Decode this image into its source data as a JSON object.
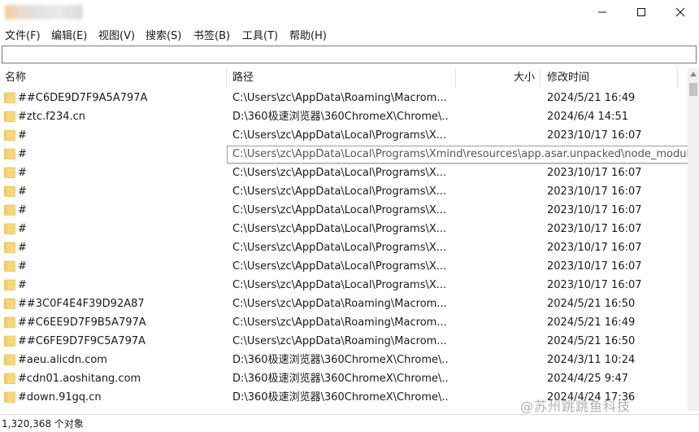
{
  "window": {
    "minimize_icon": "minimize-icon",
    "maximize_icon": "maximize-icon",
    "close_icon": "close-icon"
  },
  "menu": [
    {
      "label": "文件(F)"
    },
    {
      "label": "编辑(E)"
    },
    {
      "label": "视图(V)"
    },
    {
      "label": "搜索(S)"
    },
    {
      "label": "书签(B)"
    },
    {
      "label": "工具(T)"
    },
    {
      "label": "帮助(H)"
    }
  ],
  "search": {
    "value": ""
  },
  "columns": {
    "name": "名称",
    "path": "路径",
    "size": "大小",
    "modified": "修改时间"
  },
  "rows": [
    {
      "name": "##C6DE9D7F9A5A797A",
      "path": "C:\\Users\\zc\\AppData\\Roaming\\Macrom...",
      "modified": "2024/5/21 16:49"
    },
    {
      "name": "#ztc.f234.cn",
      "path": "D:\\360极速浏览器\\360ChromeX\\Chrome\\...",
      "modified": "2024/6/4 14:51"
    },
    {
      "name": "#",
      "path": "C:\\Users\\zc\\AppData\\Local\\Programs\\X...",
      "modified": "2023/10/17 16:07"
    },
    {
      "name": "#",
      "path": "",
      "modified": ""
    },
    {
      "name": "#",
      "path": "C:\\Users\\zc\\AppData\\Local\\Programs\\X...",
      "modified": "2023/10/17 16:07"
    },
    {
      "name": "#",
      "path": "C:\\Users\\zc\\AppData\\Local\\Programs\\X...",
      "modified": "2023/10/17 16:07"
    },
    {
      "name": "#",
      "path": "C:\\Users\\zc\\AppData\\Local\\Programs\\X...",
      "modified": "2023/10/17 16:07"
    },
    {
      "name": "#",
      "path": "C:\\Users\\zc\\AppData\\Local\\Programs\\X...",
      "modified": "2023/10/17 16:07"
    },
    {
      "name": "#",
      "path": "C:\\Users\\zc\\AppData\\Local\\Programs\\X...",
      "modified": "2023/10/17 16:07"
    },
    {
      "name": "#",
      "path": "C:\\Users\\zc\\AppData\\Local\\Programs\\X...",
      "modified": "2023/10/17 16:07"
    },
    {
      "name": "#",
      "path": "C:\\Users\\zc\\AppData\\Local\\Programs\\X...",
      "modified": "2023/10/17 16:07"
    },
    {
      "name": "##3C0F4E4F39D92A87",
      "path": "C:\\Users\\zc\\AppData\\Roaming\\Macrom...",
      "modified": "2024/5/21 16:50"
    },
    {
      "name": "##C6EE9D7F9B5A797A",
      "path": "C:\\Users\\zc\\AppData\\Roaming\\Macrom...",
      "modified": "2024/5/21 16:49"
    },
    {
      "name": "##C6FE9D7F9C5A797A",
      "path": "C:\\Users\\zc\\AppData\\Roaming\\Macrom...",
      "modified": "2024/5/21 16:50"
    },
    {
      "name": "#aeu.alicdn.com",
      "path": "D:\\360极速浏览器\\360ChromeX\\Chrome\\...",
      "modified": "2024/3/11 10:24"
    },
    {
      "name": "#cdn01.aoshitang.com",
      "path": "D:\\360极速浏览器\\360ChromeX\\Chrome\\...",
      "modified": "2024/4/25 9:47"
    },
    {
      "name": "#down.91gq.cn",
      "path": "D:\\360极速浏览器\\360ChromeX\\Chrome\\...",
      "modified": "2024/4/24 17:36"
    }
  ],
  "tooltip": {
    "text": "C:\\Users\\zc\\AppData\\Local\\Programs\\Xmind\\resources\\app.asar.unpacked\\node_modules"
  },
  "status": {
    "text": "1,320,368 个对象"
  },
  "watermark": {
    "text": "@苏州跳跳鱼科技"
  },
  "colors": {
    "folder": "#f6d77a",
    "folder_dark": "#e8c157",
    "tooltip_border": "#9e9e9e",
    "scroll_thumb": "#c2c2c2"
  }
}
